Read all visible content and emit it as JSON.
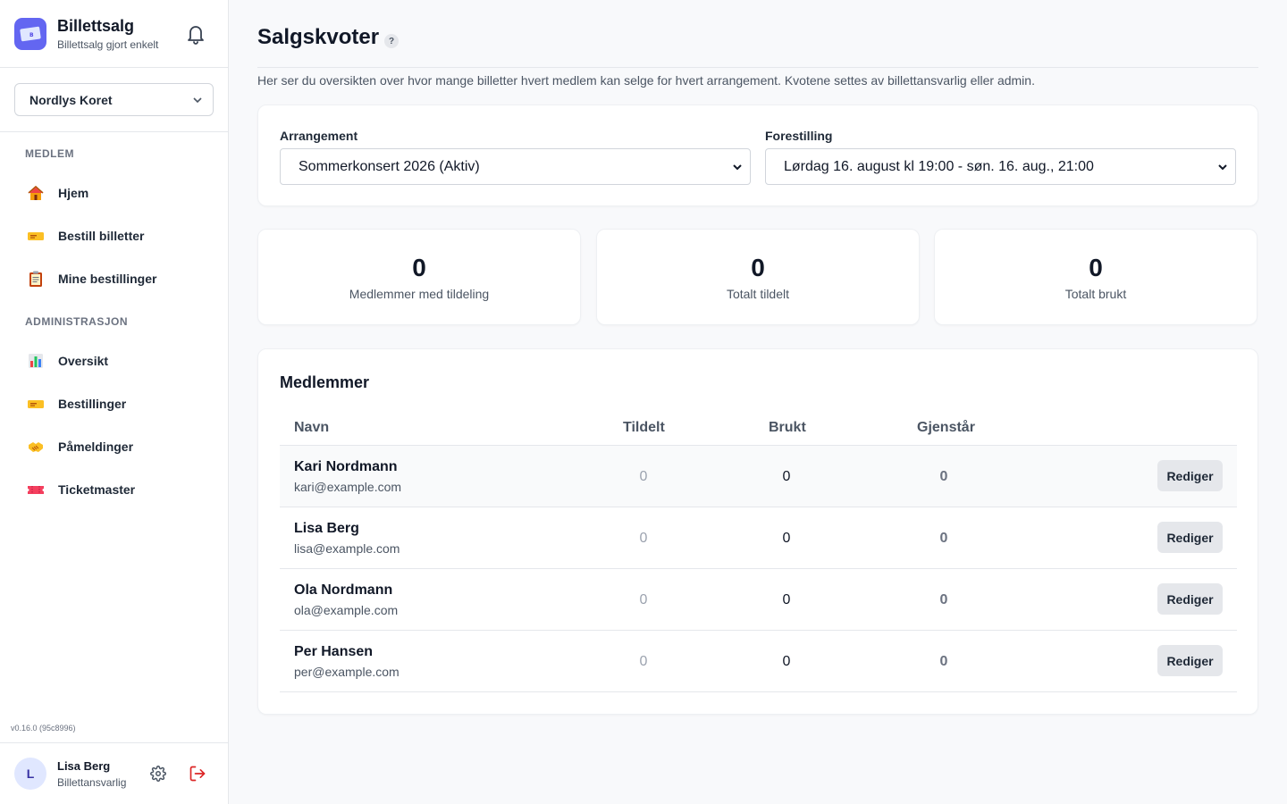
{
  "app": {
    "title": "Billettsalg",
    "subtitle": "Billettsalg gjort enkelt",
    "logo_letter": "B",
    "accent_color": "#6366f1"
  },
  "organization": {
    "selected": "Nordlys Koret"
  },
  "sidebar": {
    "sections": [
      {
        "label": "MEDLEM",
        "items": [
          {
            "label": "Hjem",
            "icon": "house-icon"
          },
          {
            "label": "Bestill billetter",
            "icon": "ticket-icon"
          },
          {
            "label": "Mine bestillinger",
            "icon": "clipboard-icon"
          }
        ]
      },
      {
        "label": "ADMINISTRASJON",
        "items": [
          {
            "label": "Oversikt",
            "icon": "bar-chart-icon"
          },
          {
            "label": "Bestillinger",
            "icon": "ticket-icon"
          },
          {
            "label": "Påmeldinger",
            "icon": "handshake-icon"
          },
          {
            "label": "Ticketmaster",
            "icon": "admission-ticket-icon"
          }
        ]
      }
    ],
    "version": "v0.16.0 (95c8996)"
  },
  "user": {
    "initial": "L",
    "name": "Lisa Berg",
    "role": "Billettansvarlig"
  },
  "page": {
    "title": "Salgskvoter",
    "help_label": "?",
    "description": "Her ser du oversikten over hvor mange billetter hvert medlem kan selge for hvert arrangement. Kvotene settes av billettansvarlig eller admin."
  },
  "filters": {
    "event_label": "Arrangement",
    "event_value": "Sommerkonsert 2026 (Aktiv)",
    "show_label": "Forestilling",
    "show_value": "Lørdag 16. august kl 19:00 - søn. 16. aug., 21:00"
  },
  "stats": [
    {
      "value": "0",
      "label": "Medlemmer med tildeling"
    },
    {
      "value": "0",
      "label": "Totalt tildelt"
    },
    {
      "value": "0",
      "label": "Totalt brukt"
    }
  ],
  "members": {
    "title": "Medlemmer",
    "columns": {
      "name": "Navn",
      "assigned": "Tildelt",
      "used": "Brukt",
      "remaining": "Gjenstår"
    },
    "edit_label": "Rediger",
    "rows": [
      {
        "name": "Kari Nordmann",
        "email": "kari@example.com",
        "assigned": "0",
        "used": "0",
        "remaining": "0"
      },
      {
        "name": "Lisa Berg",
        "email": "lisa@example.com",
        "assigned": "0",
        "used": "0",
        "remaining": "0"
      },
      {
        "name": "Ola Nordmann",
        "email": "ola@example.com",
        "assigned": "0",
        "used": "0",
        "remaining": "0"
      },
      {
        "name": "Per Hansen",
        "email": "per@example.com",
        "assigned": "0",
        "used": "0",
        "remaining": "0"
      }
    ]
  }
}
